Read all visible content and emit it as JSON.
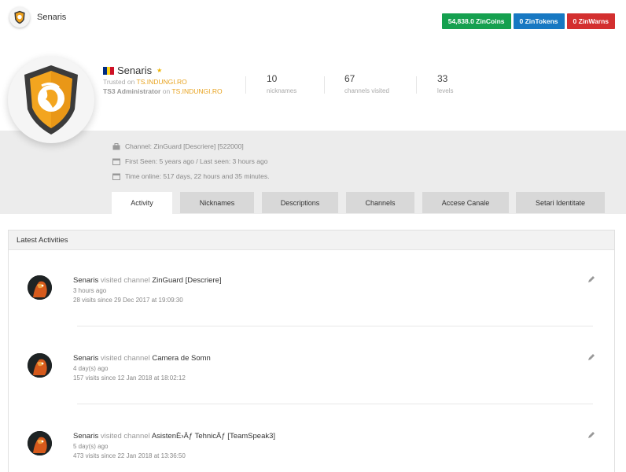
{
  "topbar": {
    "username": "Senaris",
    "zincoins": "54,838.0 ZinCoins",
    "zintokens": "0 ZinTokens",
    "zinwarns": "0 ZinWarns"
  },
  "profile": {
    "name": "Senaris",
    "trusted_prefix": "Trusted on ",
    "trusted_site": "TS.INDUNGI.RO",
    "role": "TS3 Administrator",
    "role_on": " on ",
    "role_site": "TS.INDUNGI.RO"
  },
  "stats": [
    {
      "value": "10",
      "label": "nicknames"
    },
    {
      "value": "67",
      "label": "channels visited"
    },
    {
      "value": "33",
      "label": "levels"
    }
  ],
  "info": {
    "channel": "Channel: ZinGuard [Descriere] [522000]",
    "seen": "First Seen: 5 years ago / Last seen: 3 hours ago",
    "online": "Time online: 517 days, 22 hours and 35 minutes."
  },
  "tabs": [
    "Activity",
    "Nicknames",
    "Descriptions",
    "Channels",
    "Accese Canale",
    "Setari Identitate"
  ],
  "panel_title": "Latest Activities",
  "activities": [
    {
      "user": "Senaris",
      "action": "visited channel",
      "channel": "ZinGuard [Descriere]",
      "ago": "3 hours ago",
      "visits": "28 visits since 29 Dec 2017 at 19:09:30"
    },
    {
      "user": "Senaris",
      "action": "visited channel",
      "channel": "Camera de Somn",
      "ago": "4 day(s) ago",
      "visits": "157 visits since 12 Jan 2018 at 18:02:12"
    },
    {
      "user": "Senaris",
      "action": "visited channel",
      "channel": "AsistenÈ›Äƒ TehnicÄƒ [TeamSpeak3]",
      "ago": "5 day(s) ago",
      "visits": "473 visits since 22 Jan 2018 at 13:36:50"
    }
  ],
  "colors": {
    "zincoins": "#15a04f",
    "zintokens": "#1778c2",
    "zinwarns": "#d32f2f",
    "accent": "#e8a320",
    "band": "#ececec"
  }
}
